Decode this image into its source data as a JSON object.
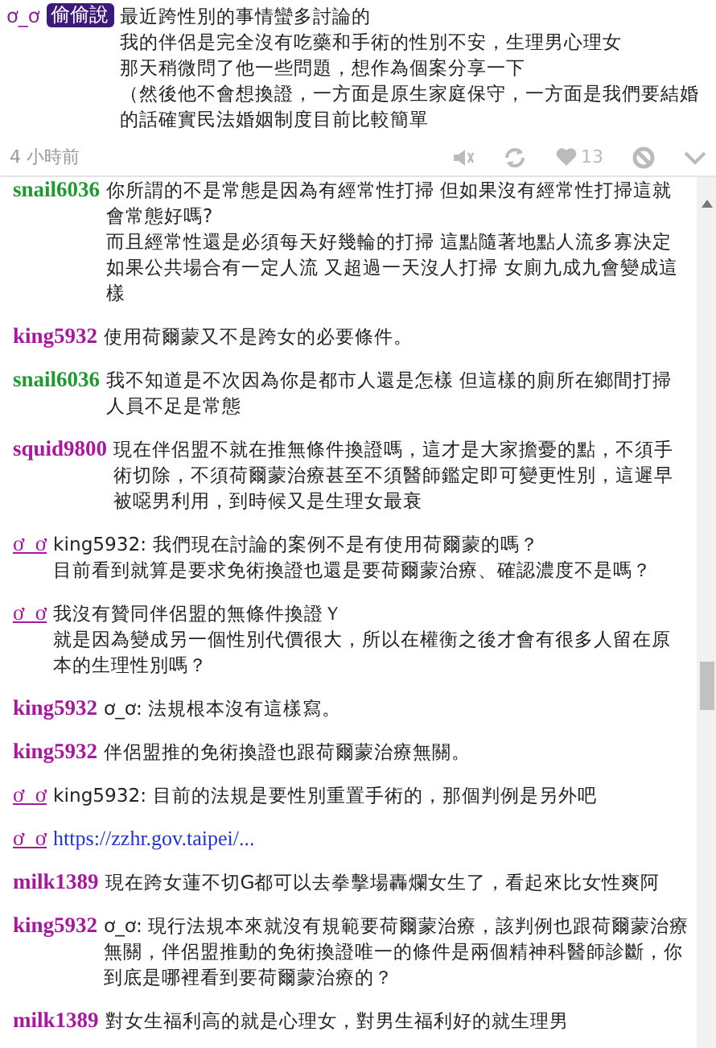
{
  "post": {
    "author": "ơ_ơ",
    "badge": "偷偷說",
    "lines": [
      "最近跨性別的事情蠻多討論的",
      "我的伴侶是完全沒有吃藥和手術的性別不安，生理男心理女",
      "那天稍微問了他一些問題，想作為個案分享一下",
      "（然後他不會想換證，一方面是原生家庭保守，一方面是我們要結婚的話確實民法婚姻制度目前比較簡單"
    ],
    "time": "4 小時前",
    "likes": "13"
  },
  "comments": [
    {
      "author": "snail6036",
      "kind": "user",
      "color": "#1e9a2e",
      "lines": [
        "你所謂的不是常態是因為有經常性打掃 但如果沒有經常性打掃這就會常態好嗎?",
        "而且經常性還是必須每天好幾輪的打掃 這點隨著地點人流多寡決定",
        "如果公共場合有一定人流 又超過一天沒人打掃 女廁九成九會變成這樣"
      ]
    },
    {
      "author": "king5932",
      "kind": "user",
      "color": "#a8179f",
      "lines": [
        "使用荷爾蒙又不是跨女的必要條件。"
      ]
    },
    {
      "author": "snail6036",
      "kind": "user",
      "color": "#1e9a2e",
      "lines": [
        "我不知道是不次因為你是都市人還是怎樣 但這樣的廁所在鄉間打掃人員不足是常態"
      ]
    },
    {
      "author": "squid9800",
      "kind": "user",
      "color": "#a8179f",
      "lines": [
        "現在伴侶盟不就在推無條件換證嗎，這才是大家擔憂的點，不須手術切除，不須荷爾蒙治療甚至不須醫師鑑定即可變更性別，這遲早被噁男利用，到時候又是生理女最衰"
      ]
    },
    {
      "author": "ơ_ơ",
      "kind": "op",
      "color": "#a8179f",
      "lines": [
        "king5932: 我們現在討論的案例不是有使用荷爾蒙的嗎？",
        "目前看到就算是要求免術換證也還是要荷爾蒙治療、確認濃度不是嗎？"
      ]
    },
    {
      "author": "ơ_ơ",
      "kind": "op",
      "color": "#a8179f",
      "lines": [
        "我沒有贊同伴侶盟的無條件換證Ｙ",
        "就是因為變成另一個性別代價很大，所以在權衡之後才會有很多人留在原本的生理性別嗎？"
      ]
    },
    {
      "author": "king5932",
      "kind": "user",
      "color": "#a8179f",
      "lines": [
        "ơ_ơ: 法規根本沒有這樣寫。"
      ]
    },
    {
      "author": "king5932",
      "kind": "user",
      "color": "#a8179f",
      "lines": [
        "伴侶盟推的免術換證也跟荷爾蒙治療無關。"
      ]
    },
    {
      "author": "ơ_ơ",
      "kind": "op",
      "color": "#a8179f",
      "lines": [
        "king5932: 目前的法規是要性別重置手術的，那個判例是另外吧"
      ]
    },
    {
      "author": "ơ_ơ",
      "kind": "op",
      "color": "#a8179f",
      "link": "https://zzhr.gov.taipei/..."
    },
    {
      "author": "milk1389",
      "kind": "user",
      "color": "#a8179f",
      "lines": [
        "現在跨女蓮不切G都可以去拳擊場轟爛女生了，看起來比女性爽阿"
      ]
    },
    {
      "author": "king5932",
      "kind": "user",
      "color": "#a8179f",
      "lines": [
        "ơ_ơ: 現行法規本來就沒有規範要荷爾蒙治療，該判例也跟荷爾蒙治療無關，伴侶盟推動的免術換證唯一的條件是兩個精神科醫師診斷，你到底是哪裡看到要荷爾蒙治療的？"
      ]
    },
    {
      "author": "milk1389",
      "kind": "user",
      "color": "#a8179f",
      "lines": [
        "對女生福利高的就是心理女，對男生福利好的就生理男"
      ]
    }
  ]
}
